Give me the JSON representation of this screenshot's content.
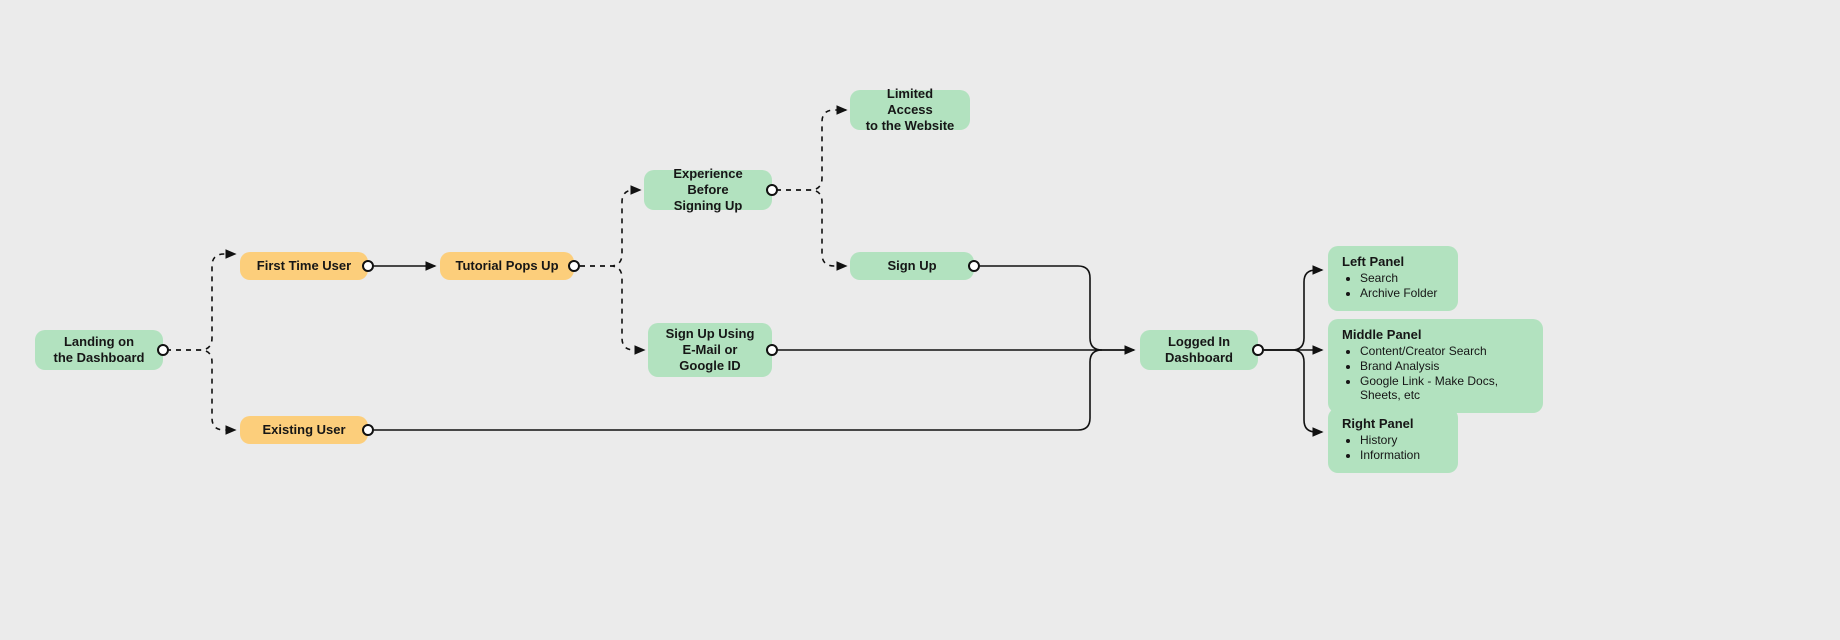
{
  "nodes": {
    "landing": {
      "label": "Landing on\nthe Dashboard"
    },
    "firstTime": {
      "label": "First Time User"
    },
    "existing": {
      "label": "Existing User"
    },
    "tutorial": {
      "label": "Tutorial Pops Up"
    },
    "expBefore": {
      "label": "Experience Before\nSigning Up"
    },
    "limited": {
      "label": "Limited Access\nto the Website"
    },
    "signup": {
      "label": "Sign Up"
    },
    "signupEmail": {
      "label": "Sign Up Using\nE-Mail or\nGoogle ID"
    },
    "loggedIn": {
      "label": "Logged In\nDashboard"
    }
  },
  "panels": {
    "left": {
      "title": "Left Panel",
      "items": [
        "Search",
        "Archive Folder"
      ]
    },
    "middle": {
      "title": "Middle Panel",
      "items": [
        "Content/Creator Search",
        "Brand Analysis",
        "Google Link - Make Docs, Sheets, etc"
      ]
    },
    "right": {
      "title": "Right Panel",
      "items": [
        "History",
        "Information"
      ]
    }
  },
  "chart_data": {
    "type": "diagram",
    "nodes": [
      {
        "id": "landing",
        "label": "Landing on the Dashboard",
        "kind": "state"
      },
      {
        "id": "firstTime",
        "label": "First Time User",
        "kind": "decision"
      },
      {
        "id": "existing",
        "label": "Existing User",
        "kind": "decision"
      },
      {
        "id": "tutorial",
        "label": "Tutorial Pops Up",
        "kind": "state"
      },
      {
        "id": "expBefore",
        "label": "Experience Before Signing Up",
        "kind": "state"
      },
      {
        "id": "limited",
        "label": "Limited Access to the Website",
        "kind": "state"
      },
      {
        "id": "signup",
        "label": "Sign Up",
        "kind": "state"
      },
      {
        "id": "signupEmail",
        "label": "Sign Up Using E-Mail or Google ID",
        "kind": "state"
      },
      {
        "id": "loggedIn",
        "label": "Logged In Dashboard",
        "kind": "state"
      },
      {
        "id": "panelLeft",
        "label": "Left Panel",
        "details": [
          "Search",
          "Archive Folder"
        ],
        "kind": "panel"
      },
      {
        "id": "panelMiddle",
        "label": "Middle Panel",
        "details": [
          "Content/Creator Search",
          "Brand Analysis",
          "Google Link - Make Docs, Sheets, etc"
        ],
        "kind": "panel"
      },
      {
        "id": "panelRight",
        "label": "Right Panel",
        "details": [
          "History",
          "Information"
        ],
        "kind": "panel"
      }
    ],
    "edges": [
      {
        "from": "landing",
        "to": "firstTime",
        "style": "dashed"
      },
      {
        "from": "landing",
        "to": "existing",
        "style": "dashed"
      },
      {
        "from": "firstTime",
        "to": "tutorial",
        "style": "solid"
      },
      {
        "from": "tutorial",
        "to": "expBefore",
        "style": "dashed"
      },
      {
        "from": "tutorial",
        "to": "signupEmail",
        "style": "dashed"
      },
      {
        "from": "expBefore",
        "to": "limited",
        "style": "dashed"
      },
      {
        "from": "expBefore",
        "to": "signup",
        "style": "dashed"
      },
      {
        "from": "signup",
        "to": "loggedIn",
        "style": "solid"
      },
      {
        "from": "signupEmail",
        "to": "loggedIn",
        "style": "solid"
      },
      {
        "from": "existing",
        "to": "loggedIn",
        "style": "solid"
      },
      {
        "from": "loggedIn",
        "to": "panelLeft",
        "style": "solid"
      },
      {
        "from": "loggedIn",
        "to": "panelMiddle",
        "style": "solid"
      },
      {
        "from": "loggedIn",
        "to": "panelRight",
        "style": "solid"
      }
    ]
  }
}
